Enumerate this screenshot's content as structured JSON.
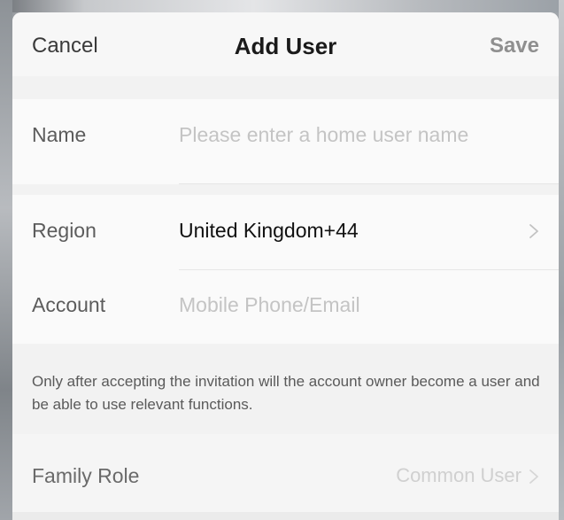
{
  "header": {
    "cancel_label": "Cancel",
    "title": "Add User",
    "save_label": "Save"
  },
  "form": {
    "name": {
      "label": "Name",
      "placeholder": "Please enter a home user name",
      "value": ""
    },
    "region": {
      "label": "Region",
      "value": "United Kingdom+44",
      "icon": "chevron-right-icon"
    },
    "account": {
      "label": "Account",
      "placeholder": "Mobile Phone/Email",
      "value": ""
    }
  },
  "note": {
    "text": "Only after accepting the invitation will the account owner become a user and be able to use relevant functions."
  },
  "family_role": {
    "label": "Family Role",
    "value": "Common User",
    "icon": "chevron-right-icon"
  },
  "colors": {
    "sheet_background": "#f2f2f2",
    "row_background": "#fafafa",
    "save_disabled": "#8f8f8f",
    "placeholder": "#c4c4c4"
  }
}
